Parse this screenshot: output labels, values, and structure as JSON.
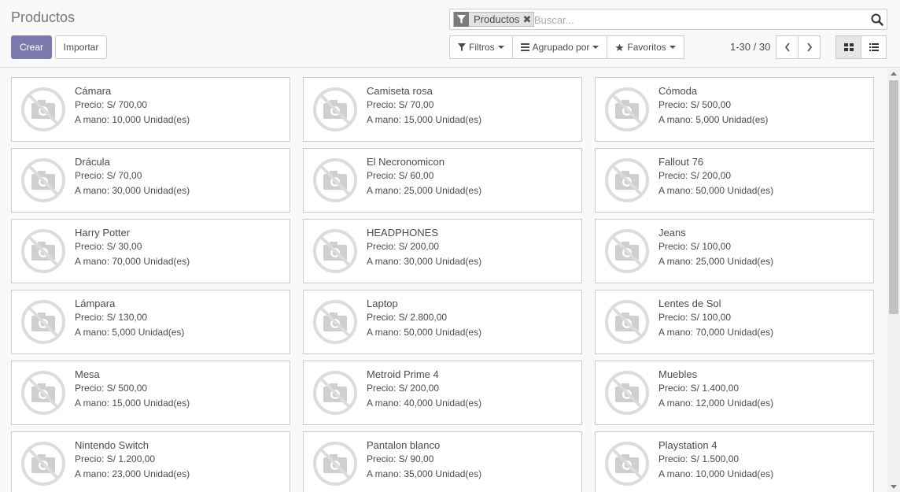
{
  "page": {
    "title": "Productos",
    "create_label": "Crear",
    "import_label": "Importar"
  },
  "search": {
    "facet_label": "Productos",
    "facet_icon": "filter-icon",
    "facet_remove": "✖",
    "placeholder": "Buscar..."
  },
  "filters": {
    "filters_label": "Filtros",
    "groupby_label": "Agrupado por",
    "favorites_label": "Favoritos"
  },
  "pager": {
    "value": "1-30 / 30"
  },
  "colors": {
    "primary": "#7c7bad",
    "placeholder_icon": "#d9d9d9"
  },
  "products": [
    {
      "name": "Cámara",
      "price": "Precio: S/ 700,00",
      "stock": "A mano: 10,000 Unidad(es)"
    },
    {
      "name": "Camiseta rosa",
      "price": "Precio: S/ 70,00",
      "stock": "A mano: 15,000 Unidad(es)"
    },
    {
      "name": "Cómoda",
      "price": "Precio: S/ 500,00",
      "stock": "A mano: 5,000 Unidad(es)"
    },
    {
      "name": "Drácula",
      "price": "Precio: S/ 70,00",
      "stock": "A mano: 30,000 Unidad(es)"
    },
    {
      "name": "El Necronomicon",
      "price": "Precio: S/ 60,00",
      "stock": "A mano: 25,000 Unidad(es)"
    },
    {
      "name": "Fallout 76",
      "price": "Precio: S/ 200,00",
      "stock": "A mano: 50,000 Unidad(es)"
    },
    {
      "name": "Harry Potter",
      "price": "Precio: S/ 30,00",
      "stock": "A mano: 70,000 Unidad(es)"
    },
    {
      "name": "HEADPHONES",
      "price": "Precio: S/ 200,00",
      "stock": "A mano: 30,000 Unidad(es)"
    },
    {
      "name": "Jeans",
      "price": "Precio: S/ 100,00",
      "stock": "A mano: 25,000 Unidad(es)"
    },
    {
      "name": "Lámpara",
      "price": "Precio: S/ 130,00",
      "stock": "A mano: 5,000 Unidad(es)"
    },
    {
      "name": "Laptop",
      "price": "Precio: S/ 2.800,00",
      "stock": "A mano: 50,000 Unidad(es)"
    },
    {
      "name": "Lentes de Sol",
      "price": "Precio: S/ 100,00",
      "stock": "A mano: 70,000 Unidad(es)"
    },
    {
      "name": "Mesa",
      "price": "Precio: S/ 500,00",
      "stock": "A mano: 15,000 Unidad(es)"
    },
    {
      "name": "Metroid Prime 4",
      "price": "Precio: S/ 200,00",
      "stock": "A mano: 40,000 Unidad(es)"
    },
    {
      "name": "Muebles",
      "price": "Precio: S/ 1.400,00",
      "stock": "A mano: 12,000 Unidad(es)"
    },
    {
      "name": "Nintendo Switch",
      "price": "Precio: S/ 1.200,00",
      "stock": "A mano: 23,000 Unidad(es)"
    },
    {
      "name": "Pantalon blanco",
      "price": "Precio: S/ 90,00",
      "stock": "A mano: 35,000 Unidad(es)"
    },
    {
      "name": "Playstation 4",
      "price": "Precio: S/ 1.500,00",
      "stock": "A mano: 10,000 Unidad(es)"
    }
  ]
}
